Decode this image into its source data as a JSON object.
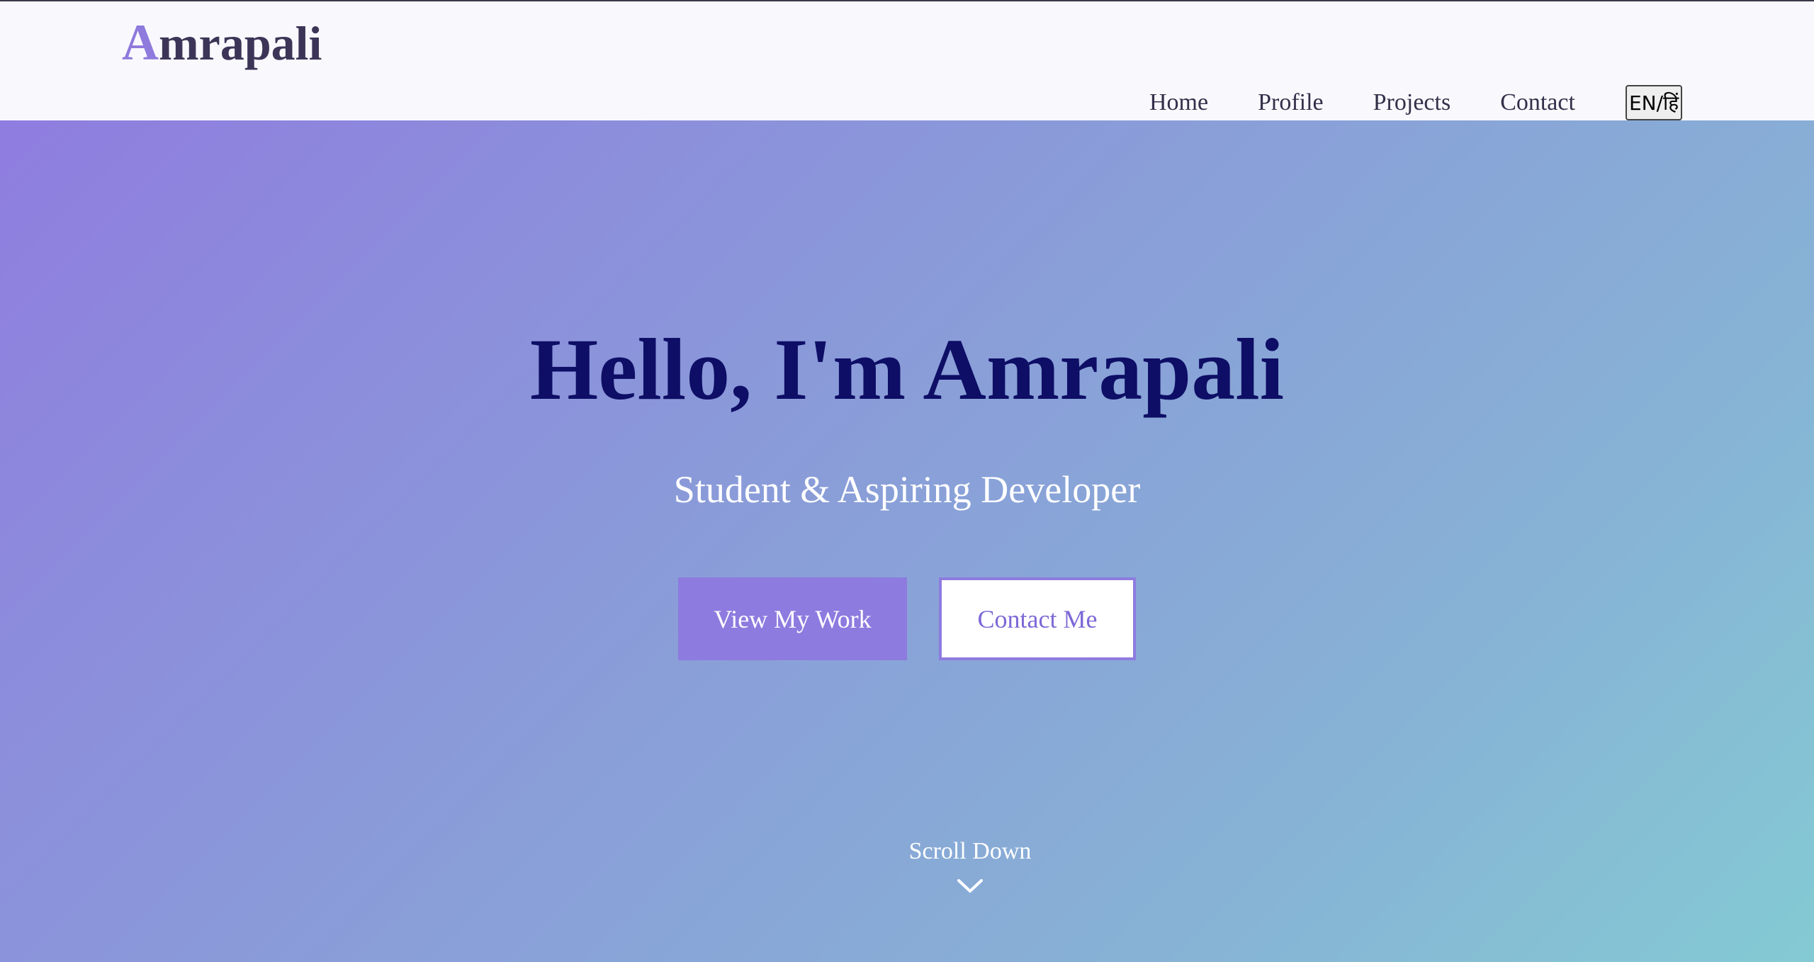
{
  "header": {
    "logo_initial": "A",
    "logo_rest": "mrapali",
    "nav": {
      "home": "Home",
      "profile": "Profile",
      "projects": "Projects",
      "contact": "Contact"
    },
    "language_toggle": "EN/हिं"
  },
  "hero": {
    "title": "Hello, I'm Amrapali",
    "subtitle": "Student & Aspiring Developer",
    "primary_button": "View My Work",
    "secondary_button": "Contact Me",
    "scroll_label": "Scroll Down",
    "scroll_icon": "chevron-down-icon"
  },
  "colors": {
    "accent": "#8e7bdf",
    "title": "#0e0e66",
    "logo_text": "#3d3557",
    "gradient_start": "#8f7ddf",
    "gradient_end": "#84cad4"
  }
}
